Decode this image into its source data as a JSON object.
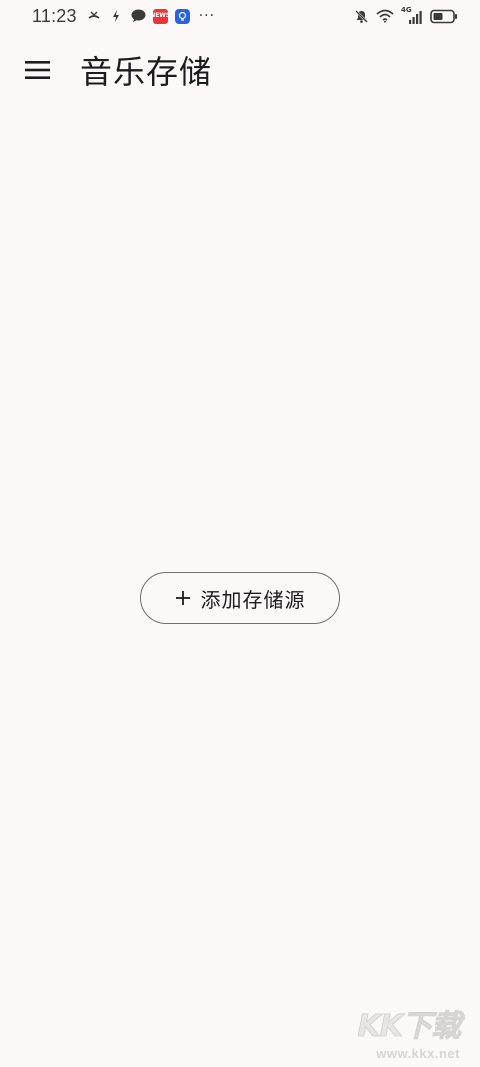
{
  "status_bar": {
    "time": "11:23",
    "notifications": [
      "missed-call-icon",
      "charging-icon",
      "chat-bubble-icon",
      "news-app-icon",
      "assistant-app-icon"
    ],
    "news_badge_text": "NEWS",
    "more": "···",
    "right_icons": [
      "mute-icon",
      "wifi-icon",
      "4g-signal-icon",
      "battery-icon"
    ],
    "network_label": "4G"
  },
  "app_bar": {
    "menu_icon": "hamburger-menu-icon",
    "title": "音乐存储"
  },
  "main": {
    "add_source_button": {
      "icon": "plus-icon",
      "label": "添加存储源"
    }
  },
  "watermark": {
    "logo_text": "KK下载",
    "url_text": "www.kkx.net"
  },
  "colors": {
    "background": "#fcf8f7",
    "text": "#1c1b1f",
    "button_outline": "#6f6f6f"
  }
}
